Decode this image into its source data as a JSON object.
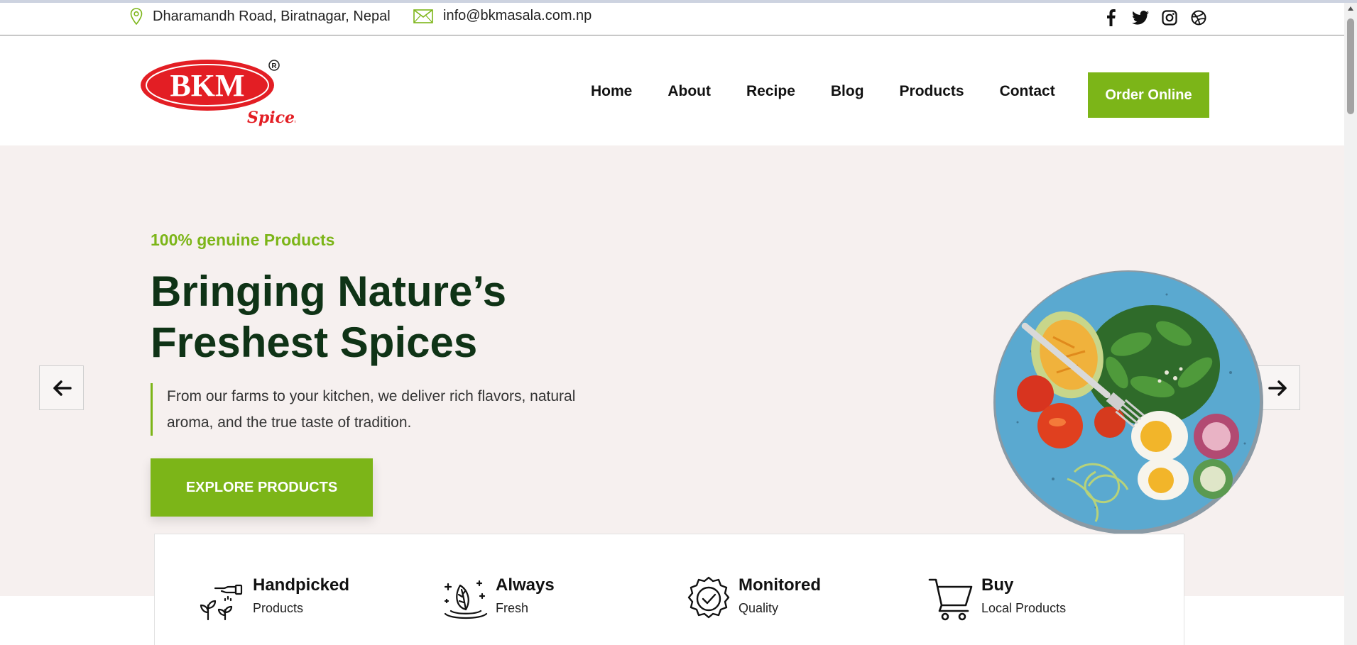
{
  "topbar": {
    "address": "Dharamandh Road, Biratnagar, Nepal",
    "email": "info@bkmasala.com.np",
    "social": [
      "facebook-icon",
      "twitter-icon",
      "instagram-icon",
      "dribbble-icon"
    ]
  },
  "logo": {
    "main": "BKM",
    "sub": "Spices",
    "reg": "®"
  },
  "nav": {
    "items": [
      "Home",
      "About",
      "Recipe",
      "Blog",
      "Products",
      "Contact"
    ],
    "cta": "Order Online"
  },
  "hero": {
    "tagline": "100% genuine Products",
    "title_line1": "Bringing Nature’s",
    "title_line2": "Freshest Spices",
    "description": "From our farms to your kitchen, we deliver rich flavors, natural aroma, and the true taste of tradition.",
    "button": "EXPLORE PRODUCTS"
  },
  "features": [
    {
      "title": "Handpicked",
      "subtitle": "Products",
      "icon": "plant-hand-icon"
    },
    {
      "title": "Always",
      "subtitle": "Fresh",
      "icon": "fresh-leaf-icon"
    },
    {
      "title": "Monitored",
      "subtitle": "Quality",
      "icon": "quality-badge-icon"
    },
    {
      "title": "Buy",
      "subtitle": "Local Products",
      "icon": "cart-icon"
    }
  ],
  "colors": {
    "accent": "#7cb518",
    "heading": "#0f3316",
    "hero_bg": "#f6f0ef",
    "logo_red": "#e31e24"
  }
}
